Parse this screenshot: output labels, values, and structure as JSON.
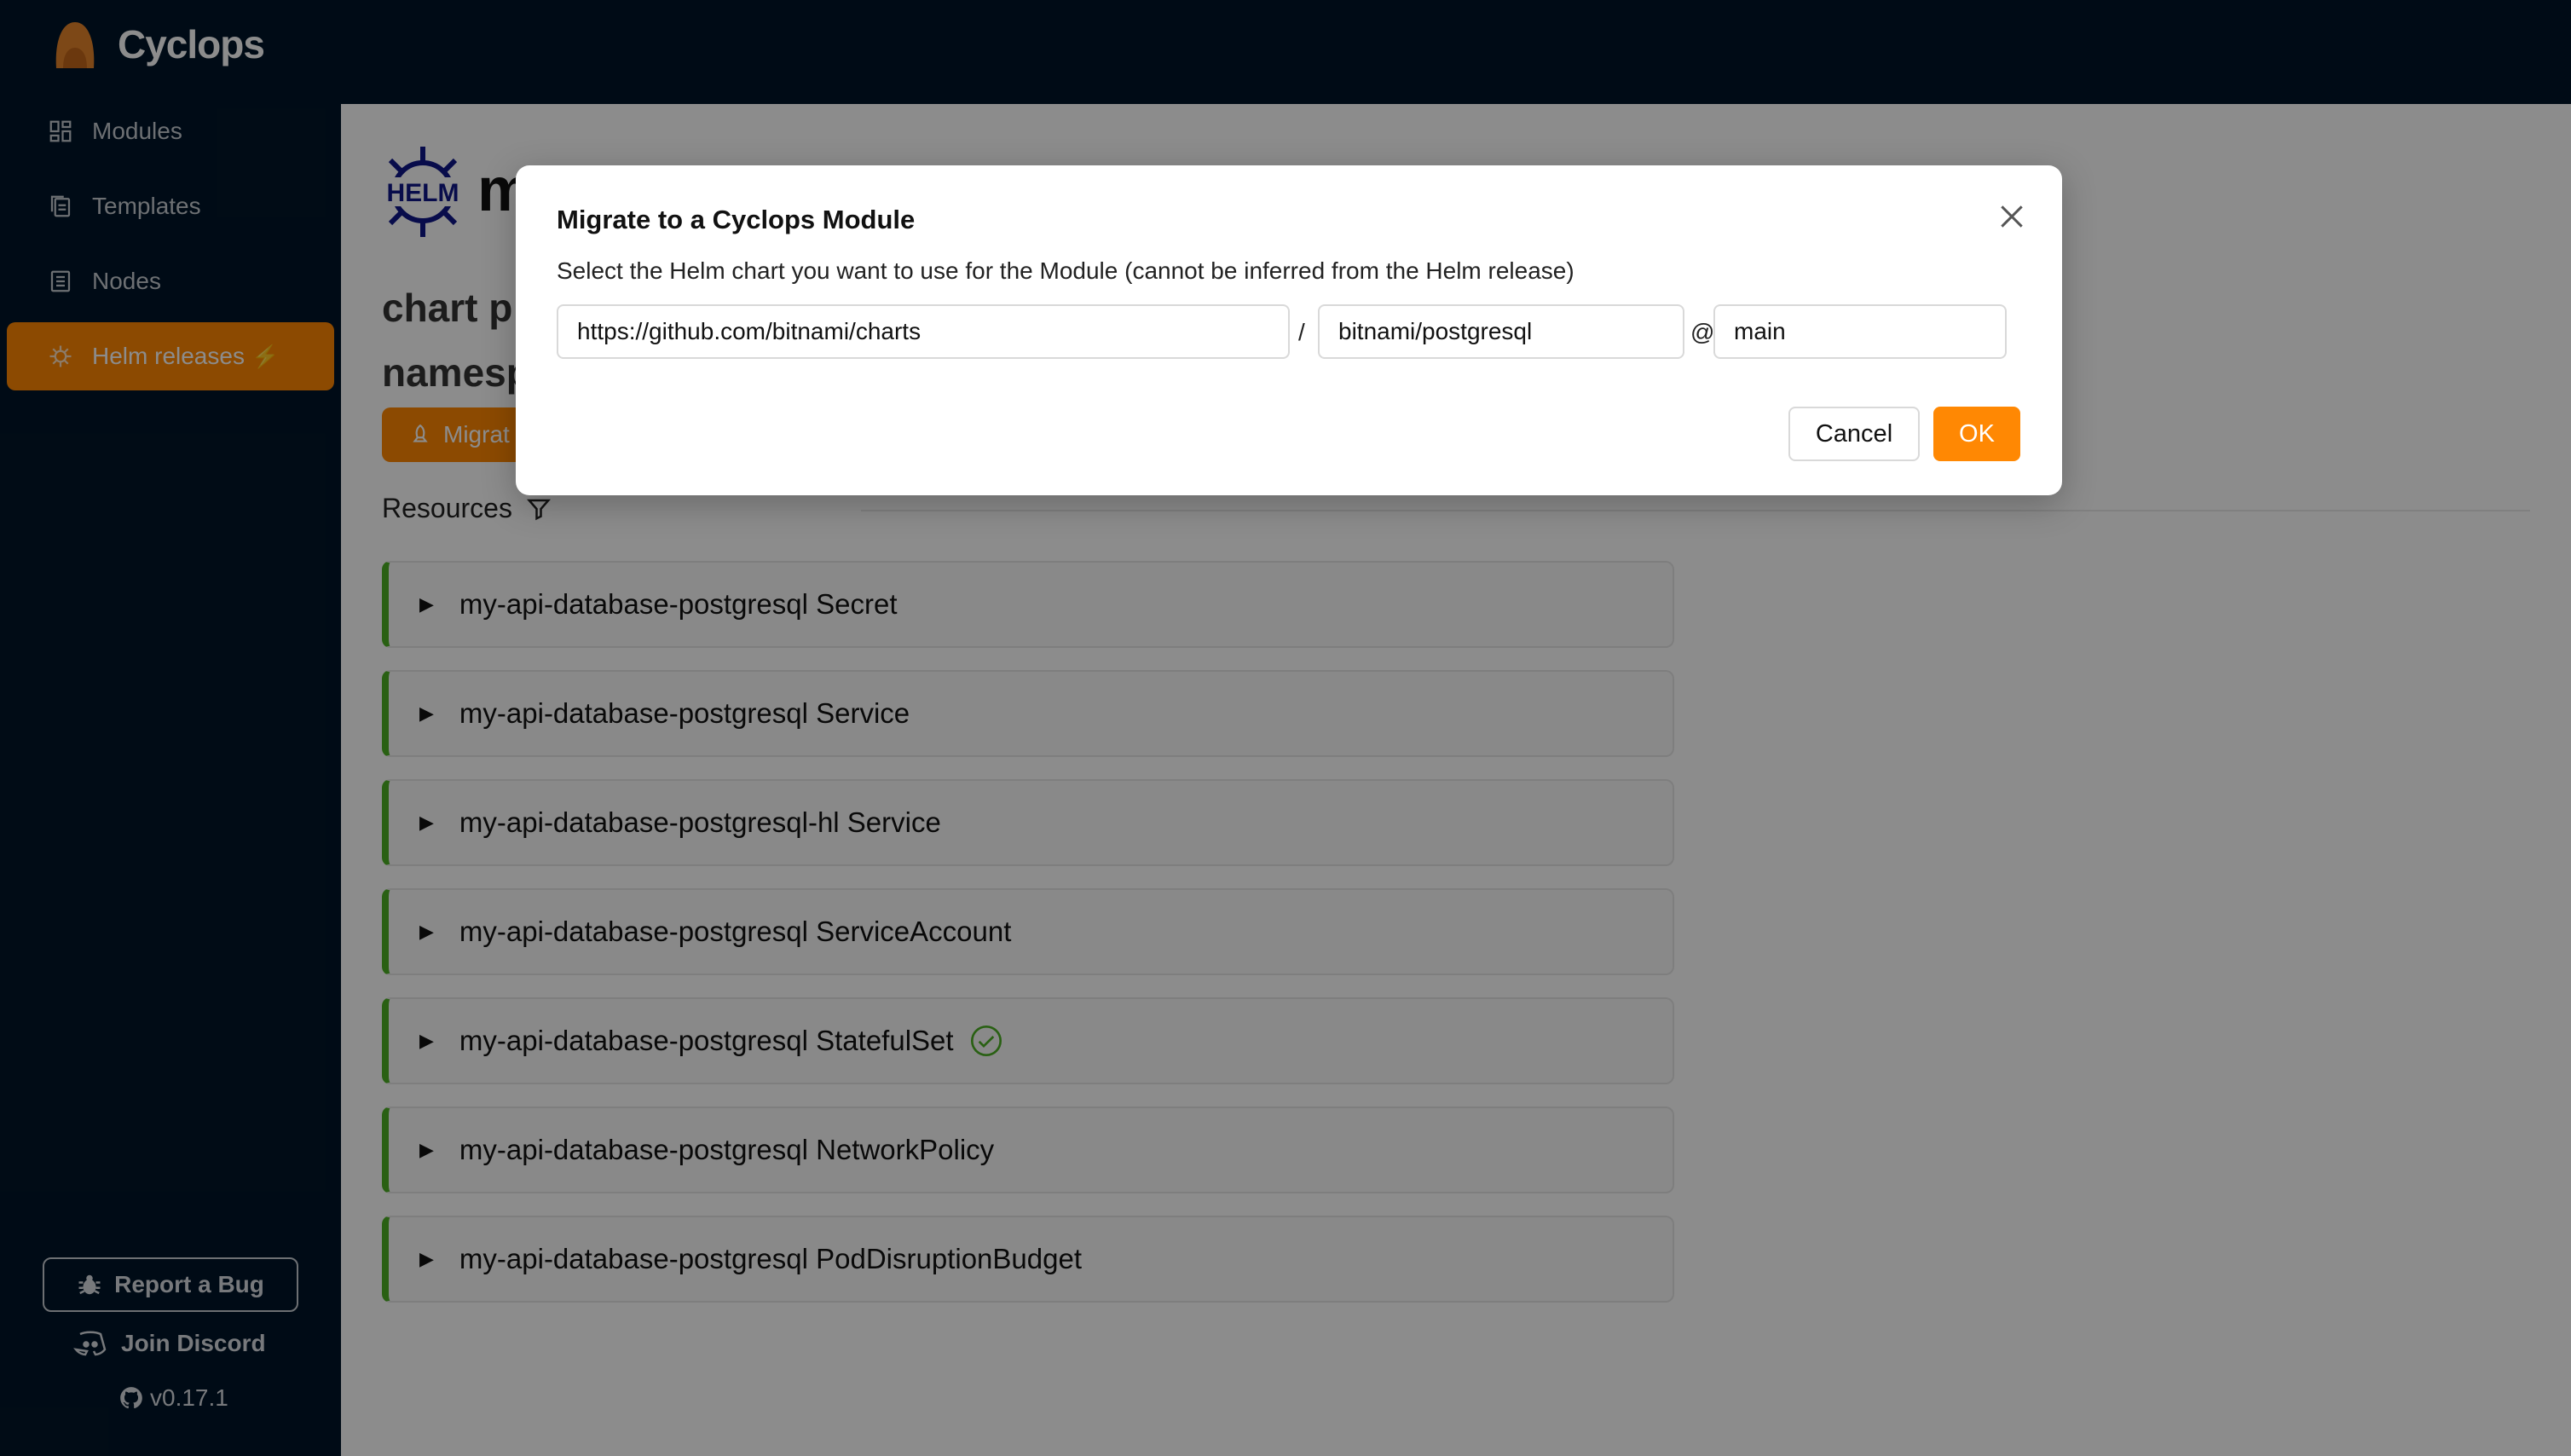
{
  "app": {
    "name": "Cyclops",
    "version": "v0.17.1"
  },
  "colors": {
    "accent": "#ff8803",
    "sidebar_bg": "#011528",
    "status_ok": "#4caf23"
  },
  "sidebar": {
    "items": [
      {
        "label": "Modules",
        "icon": "grid-icon",
        "active": false
      },
      {
        "label": "Templates",
        "icon": "copy-icon",
        "active": false
      },
      {
        "label": "Nodes",
        "icon": "server-icon",
        "active": false
      },
      {
        "label": "Helm releases",
        "icon": "helm-wheel-icon",
        "active": true,
        "badge_icon": "lightning-icon"
      }
    ],
    "report_bug": "Report a Bug",
    "join_discord": "Join Discord"
  },
  "release": {
    "title_fragment": "m",
    "chart_label": "chart",
    "chart_fragment": "p",
    "namespace_label": "namesp",
    "migrate_button": "Migrat"
  },
  "resources": {
    "heading": "Resources",
    "items": [
      {
        "label": "my-api-database-postgresql Secret",
        "healthy": false
      },
      {
        "label": "my-api-database-postgresql Service",
        "healthy": false
      },
      {
        "label": "my-api-database-postgresql-hl Service",
        "healthy": false
      },
      {
        "label": "my-api-database-postgresql ServiceAccount",
        "healthy": false
      },
      {
        "label": "my-api-database-postgresql StatefulSet",
        "healthy": true
      },
      {
        "label": "my-api-database-postgresql NetworkPolicy",
        "healthy": false
      },
      {
        "label": "my-api-database-postgresql PodDisruptionBudget",
        "healthy": false
      }
    ]
  },
  "modal": {
    "title": "Migrate to a Cyclops Module",
    "description": "Select the Helm chart you want to use for the Module (cannot be inferred from the Helm release)",
    "repo_value": "https://github.com/bitnami/charts",
    "path_separator": "/",
    "path_value": "bitnami/postgresql",
    "version_separator": "@",
    "version_value": "main",
    "cancel_label": "Cancel",
    "ok_label": "OK"
  }
}
